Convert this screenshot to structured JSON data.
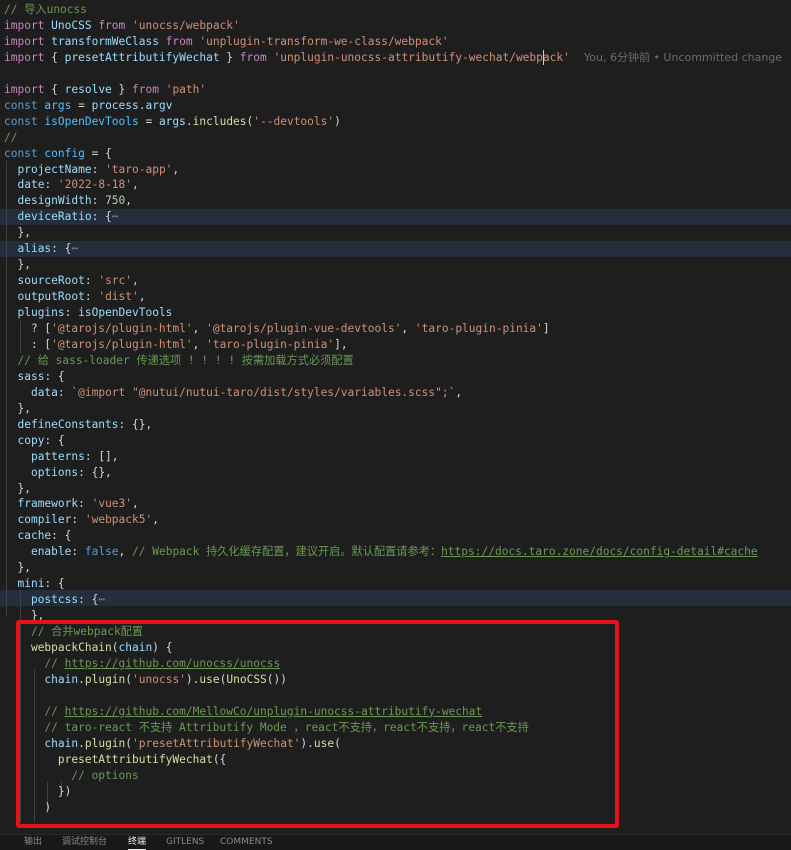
{
  "editor": {
    "blame": "You, 6分钟前 • Uncommitted change",
    "lines": [
      [
        [
          "c",
          "// 导入unocss"
        ]
      ],
      [
        [
          "k",
          "import "
        ],
        [
          "v",
          "UnoCSS"
        ],
        [
          "k",
          " from "
        ],
        [
          "s",
          "'unocss/webpack'"
        ]
      ],
      [
        [
          "k",
          "import "
        ],
        [
          "v",
          "transformWeClass"
        ],
        [
          "k",
          " from "
        ],
        [
          "s",
          "'unplugin-transform-we-class/webpack'"
        ]
      ],
      [
        [
          "k",
          "import "
        ],
        [
          "p",
          "{ "
        ],
        [
          "v",
          "presetAttributifyWechat"
        ],
        [
          "p",
          " } "
        ],
        [
          "k",
          "from "
        ],
        [
          "s",
          "'unplugin-unocss-attributify-wechat/webpack'"
        ]
      ],
      [],
      [
        [
          "k",
          "import "
        ],
        [
          "p",
          "{ "
        ],
        [
          "v",
          "resolve"
        ],
        [
          "p",
          " } "
        ],
        [
          "k",
          "from "
        ],
        [
          "s",
          "'path'"
        ]
      ],
      [
        [
          "b",
          "const "
        ],
        [
          "vc",
          "args"
        ],
        [
          "p",
          " = "
        ],
        [
          "v",
          "process"
        ],
        [
          "p",
          "."
        ],
        [
          "v",
          "argv"
        ]
      ],
      [
        [
          "b",
          "const "
        ],
        [
          "vc",
          "isOpenDevTools"
        ],
        [
          "p",
          " = "
        ],
        [
          "v",
          "args"
        ],
        [
          "p",
          "."
        ],
        [
          "f",
          "includes"
        ],
        [
          "p",
          "("
        ],
        [
          "s",
          "'--devtools'"
        ],
        [
          "p",
          ")"
        ]
      ],
      [
        [
          "c",
          "//"
        ]
      ],
      [
        [
          "b",
          "const "
        ],
        [
          "vc",
          "config"
        ],
        [
          "p",
          " = {"
        ]
      ],
      [
        [
          "p",
          "  "
        ],
        [
          "v",
          "projectName"
        ],
        [
          "p",
          ": "
        ],
        [
          "s",
          "'taro-app'"
        ],
        [
          "p",
          ","
        ]
      ],
      [
        [
          "p",
          "  "
        ],
        [
          "v",
          "date"
        ],
        [
          "p",
          ": "
        ],
        [
          "s",
          "'2022-8-18'"
        ],
        [
          "p",
          ","
        ]
      ],
      [
        [
          "p",
          "  "
        ],
        [
          "v",
          "designWidth"
        ],
        [
          "p",
          ": "
        ],
        [
          "n",
          "750"
        ],
        [
          "p",
          ","
        ]
      ],
      [
        [
          "p",
          "  "
        ],
        [
          "v",
          "deviceRatio"
        ],
        [
          "p",
          ": {"
        ],
        [
          "fold",
          "⋯"
        ]
      ],
      [
        [
          "p",
          "  },"
        ]
      ],
      [
        [
          "p",
          "  "
        ],
        [
          "v",
          "alias"
        ],
        [
          "p",
          ": {"
        ],
        [
          "fold",
          "⋯"
        ]
      ],
      [
        [
          "p",
          "  },"
        ]
      ],
      [
        [
          "p",
          "  "
        ],
        [
          "v",
          "sourceRoot"
        ],
        [
          "p",
          ": "
        ],
        [
          "s",
          "'src'"
        ],
        [
          "p",
          ","
        ]
      ],
      [
        [
          "p",
          "  "
        ],
        [
          "v",
          "outputRoot"
        ],
        [
          "p",
          ": "
        ],
        [
          "s",
          "'dist'"
        ],
        [
          "p",
          ","
        ]
      ],
      [
        [
          "p",
          "  "
        ],
        [
          "v",
          "plugins"
        ],
        [
          "p",
          ": "
        ],
        [
          "v",
          "isOpenDevTools"
        ]
      ],
      [
        [
          "p",
          "    ? ["
        ],
        [
          "s",
          "'@tarojs/plugin-html'"
        ],
        [
          "p",
          ", "
        ],
        [
          "s",
          "'@tarojs/plugin-vue-devtools'"
        ],
        [
          "p",
          ", "
        ],
        [
          "s",
          "'taro-plugin-pinia'"
        ],
        [
          "p",
          "]"
        ]
      ],
      [
        [
          "p",
          "    : ["
        ],
        [
          "s",
          "'@tarojs/plugin-html'"
        ],
        [
          "p",
          ", "
        ],
        [
          "s",
          "'taro-plugin-pinia'"
        ],
        [
          "p",
          "],"
        ]
      ],
      [
        [
          "p",
          "  "
        ],
        [
          "c",
          "// 给 sass-loader 传递选项 ! ! ! ! 按需加载方式必须配置"
        ]
      ],
      [
        [
          "p",
          "  "
        ],
        [
          "v",
          "sass"
        ],
        [
          "p",
          ": {"
        ]
      ],
      [
        [
          "p",
          "    "
        ],
        [
          "v",
          "data"
        ],
        [
          "p",
          ": "
        ],
        [
          "s",
          "`@import \"@nutui/nutui-taro/dist/styles/variables.scss\";`"
        ],
        [
          "p",
          ","
        ]
      ],
      [
        [
          "p",
          "  },"
        ]
      ],
      [
        [
          "p",
          "  "
        ],
        [
          "v",
          "defineConstants"
        ],
        [
          "p",
          ": {},"
        ]
      ],
      [
        [
          "p",
          "  "
        ],
        [
          "v",
          "copy"
        ],
        [
          "p",
          ": {"
        ]
      ],
      [
        [
          "p",
          "    "
        ],
        [
          "v",
          "patterns"
        ],
        [
          "p",
          ": [],"
        ]
      ],
      [
        [
          "p",
          "    "
        ],
        [
          "v",
          "options"
        ],
        [
          "p",
          ": {},"
        ]
      ],
      [
        [
          "p",
          "  },"
        ]
      ],
      [
        [
          "p",
          "  "
        ],
        [
          "v",
          "framework"
        ],
        [
          "p",
          ": "
        ],
        [
          "s",
          "'vue3'"
        ],
        [
          "p",
          ","
        ]
      ],
      [
        [
          "p",
          "  "
        ],
        [
          "v",
          "compiler"
        ],
        [
          "p",
          ": "
        ],
        [
          "s",
          "'webpack5'"
        ],
        [
          "p",
          ","
        ]
      ],
      [
        [
          "p",
          "  "
        ],
        [
          "v",
          "cache"
        ],
        [
          "p",
          ": {"
        ]
      ],
      [
        [
          "p",
          "    "
        ],
        [
          "v",
          "enable"
        ],
        [
          "p",
          ": "
        ],
        [
          "b",
          "false"
        ],
        [
          "p",
          ", "
        ],
        [
          "c",
          "// Webpack 持久化缓存配置，建议开启。默认配置请参考："
        ],
        [
          "u",
          "https://docs.taro.zone/docs/config-detail#cache"
        ]
      ],
      [
        [
          "p",
          "  },"
        ]
      ],
      [
        [
          "p",
          "  "
        ],
        [
          "v",
          "mini"
        ],
        [
          "p",
          ": {"
        ]
      ],
      [
        [
          "p",
          "    "
        ],
        [
          "v",
          "postcss"
        ],
        [
          "p",
          ": {"
        ],
        [
          "fold",
          "⋯"
        ]
      ],
      [
        [
          "p",
          "    },"
        ]
      ],
      [
        [
          "p",
          "    "
        ],
        [
          "c",
          "// 合并webpack配置"
        ]
      ],
      [
        [
          "p",
          "    "
        ],
        [
          "f",
          "webpackChain"
        ],
        [
          "p",
          "("
        ],
        [
          "v",
          "chain"
        ],
        [
          "p",
          ") {"
        ]
      ],
      [
        [
          "p",
          "      "
        ],
        [
          "c",
          "// "
        ],
        [
          "u",
          "https://github.com/unocss/unocss"
        ]
      ],
      [
        [
          "p",
          "      "
        ],
        [
          "v",
          "chain"
        ],
        [
          "p",
          "."
        ],
        [
          "f",
          "plugin"
        ],
        [
          "p",
          "("
        ],
        [
          "s",
          "'unocss'"
        ],
        [
          "p",
          ")."
        ],
        [
          "f",
          "use"
        ],
        [
          "p",
          "("
        ],
        [
          "f",
          "UnoCSS"
        ],
        [
          "p",
          "())"
        ]
      ],
      [],
      [
        [
          "p",
          "      "
        ],
        [
          "c",
          "// "
        ],
        [
          "u",
          "https://github.com/MellowCo/unplugin-unocss-attributify-wechat"
        ]
      ],
      [
        [
          "p",
          "      "
        ],
        [
          "c",
          "// taro-react 不支持 Attributify Mode ，react不支持，react不支持，react不支持"
        ]
      ],
      [
        [
          "p",
          "      "
        ],
        [
          "v",
          "chain"
        ],
        [
          "p",
          "."
        ],
        [
          "f",
          "plugin"
        ],
        [
          "p",
          "("
        ],
        [
          "s",
          "'presetAttributifyWechat'"
        ],
        [
          "p",
          ")."
        ],
        [
          "f",
          "use"
        ],
        [
          "p",
          "("
        ]
      ],
      [
        [
          "p",
          "        "
        ],
        [
          "f",
          "presetAttributifyWechat"
        ],
        [
          "p",
          "({"
        ]
      ],
      [
        [
          "p",
          "          "
        ],
        [
          "c",
          "// options"
        ]
      ],
      [
        [
          "p",
          "        })"
        ]
      ],
      [
        [
          "p",
          "      )"
        ]
      ]
    ]
  },
  "panel": {
    "tabs": [
      {
        "label": "输出",
        "active": false
      },
      {
        "label": "调试控制台",
        "active": false
      },
      {
        "label": "终端",
        "active": true
      },
      {
        "label": "GITLENS",
        "active": false
      },
      {
        "label": "COMMENTS",
        "active": false
      }
    ]
  },
  "colors": {
    "annotation_box": "#e3121b",
    "background": "#1e1e1e"
  }
}
